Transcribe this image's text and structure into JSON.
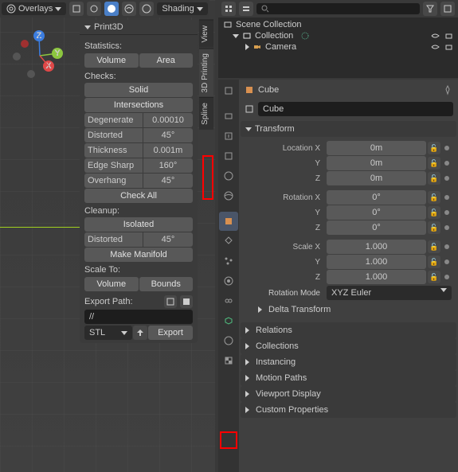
{
  "header": {
    "overlays": "Overlays",
    "shading": "Shading"
  },
  "gizmo": {
    "x": "X",
    "y": "Y",
    "z": "Z"
  },
  "panel": {
    "title": "Print3D",
    "stats_label": "Statistics:",
    "volume": "Volume",
    "area": "Area",
    "checks_label": "Checks:",
    "solid": "Solid",
    "intersections": "Intersections",
    "rows": [
      {
        "k": "Degenerate",
        "v": "0.00010"
      },
      {
        "k": "Distorted",
        "v": "45°"
      },
      {
        "k": "Thickness",
        "v": "0.001m"
      },
      {
        "k": "Edge Sharp",
        "v": "160°"
      },
      {
        "k": "Overhang",
        "v": "45°"
      }
    ],
    "check_all": "Check All",
    "cleanup_label": "Cleanup:",
    "isolated": "Isolated",
    "cleanup_rows": [
      {
        "k": "Distorted",
        "v": "45°"
      }
    ],
    "make_manifold": "Make Manifold",
    "scale_label": "Scale To:",
    "scale_volume": "Volume",
    "scale_bounds": "Bounds",
    "export_label": "Export Path:",
    "export_path": "//",
    "export_format": "STL",
    "export_btn": "Export"
  },
  "vtabs": [
    "View",
    "3D Printing",
    "Spline"
  ],
  "outliner": {
    "scene": "Scene Collection",
    "collection": "Collection",
    "camera": "Camera"
  },
  "props": {
    "breadcrumb": "Cube",
    "obj_name": "Cube",
    "transform": "Transform",
    "location": "Location X",
    "rotation": "Rotation X",
    "scale": "Scale X",
    "y": "Y",
    "z": "Z",
    "loc_vals": [
      "0m",
      "0m",
      "0m"
    ],
    "rot_vals": [
      "0°",
      "0°",
      "0°"
    ],
    "scale_vals": [
      "1.000",
      "1.000",
      "1.000"
    ],
    "rot_mode_label": "Rotation Mode",
    "rot_mode": "XYZ Euler",
    "delta": "Delta Transform",
    "sections": [
      "Relations",
      "Collections",
      "Instancing",
      "Motion Paths",
      "Viewport Display",
      "Custom Properties"
    ]
  }
}
